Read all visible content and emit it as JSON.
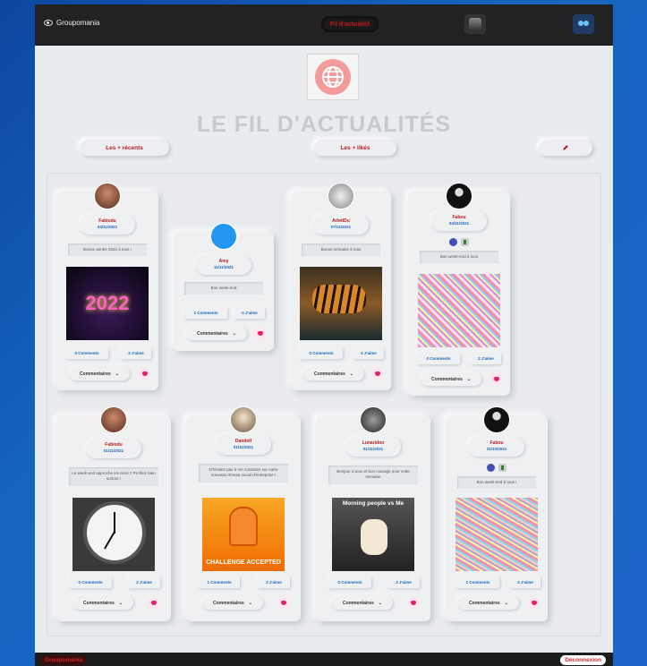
{
  "header": {
    "brand": "Groupomania",
    "nav_active": "Fil d'actualité"
  },
  "page": {
    "title": "LE FIL D'ACTUALITÉS",
    "filters": {
      "recent": "Les + récents",
      "liked": "Les + likés"
    }
  },
  "posts": [
    {
      "author": "Fabiodu",
      "date": "04/11/2021",
      "text": "Bonne année 2022 à tous !",
      "image": "new-year-2022-fireworks",
      "comments": "0 Comments",
      "likes": "2 J'aime",
      "comments_label": "Commentaires"
    },
    {
      "author": "Amy",
      "date": "11/11/2021",
      "text": "Bon week-end",
      "comments": "1 Comments",
      "likes": "0 J'aime",
      "comments_label": "Commentaires"
    },
    {
      "author": "ArlettDu",
      "date": "07/11/2021",
      "text": "Bonne semaine à tous",
      "image": "tiger-drinking-water",
      "comments": "0 Comments",
      "likes": "2 J'aime",
      "comments_label": "Commentaires"
    },
    {
      "author": "Fabou",
      "date": "04/11/2021",
      "text": "Bon week-end à tous",
      "image": "mosaic-image",
      "comments": "0 Comments",
      "likes": "2 J'aime",
      "comments_label": "Commentaires"
    },
    {
      "author": "Fabiodu",
      "date": "01/11/2021",
      "text": "Le week-end approche les amis !! Profitez bien surtout !",
      "image": "wall-clock",
      "comments": "0 Comments",
      "likes": "2 J'aime",
      "comments_label": "Commentaires"
    },
    {
      "author": "Dandelf",
      "date": "01/11/2021",
      "text": "N'hésitez pas à me contacter sur notre nouveau réseau social d'entreprise !",
      "image": "challenge-accepted-meme",
      "image_caption": "CHALLENGE ACCEPTED",
      "comments": "1 Comments",
      "likes": "2 J'aime",
      "comments_label": "Commentaires"
    },
    {
      "author": "Lunaridoo",
      "date": "01/11/2021",
      "text": "Bonjour à tous et bon courage pour cette semaine",
      "image": "morning-dog-meme",
      "image_caption": "Morning people vs Me",
      "comments": "0 Comments",
      "likes": "3 J'aime",
      "comments_label": "Commentaires"
    },
    {
      "author": "Fabou",
      "date": "31/10/2021",
      "text": "Bon week-end à tous !",
      "image": "mosaic-image",
      "comments": "1 Comments",
      "likes": "2 J'aime",
      "comments_label": "Commentaires"
    }
  ],
  "footer": {
    "left_label": "Groupomania",
    "logout_label": "Déconnexion"
  },
  "colors": {
    "accent_red": "#b71c1c",
    "accent_blue": "#1565c0",
    "like_pink": "#e91e63"
  }
}
